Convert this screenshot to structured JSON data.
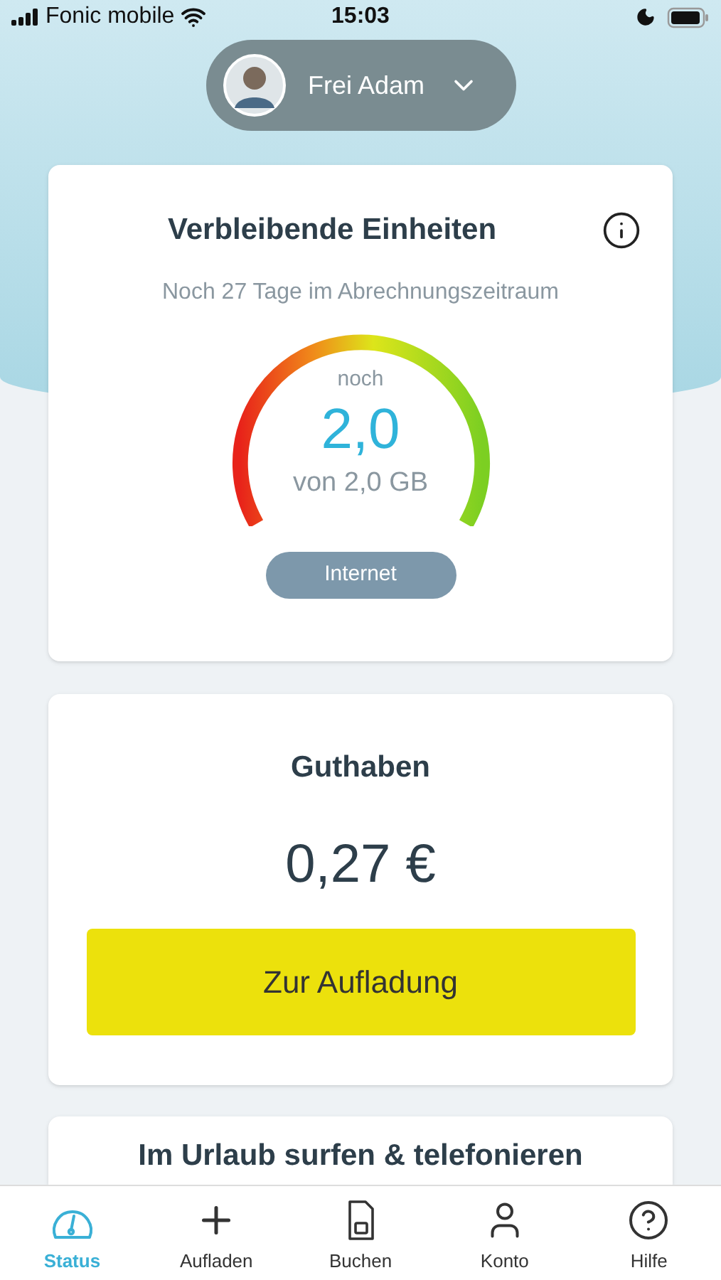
{
  "status_bar": {
    "carrier": "Fonic mobile",
    "time": "15:03"
  },
  "profile": {
    "name": "Frei Adam"
  },
  "units_card": {
    "title": "Verbleibende Einheiten",
    "subtitle": "Noch 27 Tage im Abrechnungszeitraum",
    "gauge": {
      "caption": "noch",
      "value": "2,0",
      "total": "von 2,0 GB"
    },
    "type_button": "Internet"
  },
  "balance_card": {
    "title": "Guthaben",
    "amount": "0,27 €",
    "button": "Zur Aufladung"
  },
  "promo_card": {
    "title": "Im Urlaub surfen & telefonieren"
  },
  "tabs": [
    {
      "kind": "status",
      "label": "Status",
      "selected": true
    },
    {
      "kind": "topup",
      "label": "Aufladen",
      "selected": false
    },
    {
      "kind": "book",
      "label": "Buchen",
      "selected": false
    },
    {
      "kind": "account",
      "label": "Konto",
      "selected": false
    },
    {
      "kind": "help",
      "label": "Hilfe",
      "selected": false
    }
  ]
}
